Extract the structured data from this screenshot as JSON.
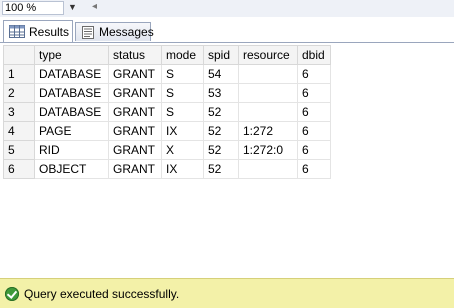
{
  "zoom": {
    "value": "100 %"
  },
  "tabs": [
    {
      "label": "Results",
      "icon": "grid-icon",
      "active": true
    },
    {
      "label": "Messages",
      "icon": "messages-icon",
      "active": false
    }
  ],
  "grid": {
    "columns": [
      "type",
      "status",
      "mode",
      "spid",
      "resource",
      "dbid"
    ],
    "rows": [
      {
        "num": "1",
        "cells": [
          "DATABASE",
          "GRANT",
          "S",
          "54",
          "",
          "6"
        ]
      },
      {
        "num": "2",
        "cells": [
          "DATABASE",
          "GRANT",
          "S",
          "53",
          "",
          "6"
        ]
      },
      {
        "num": "3",
        "cells": [
          "DATABASE",
          "GRANT",
          "S",
          "52",
          "",
          "6"
        ]
      },
      {
        "num": "4",
        "cells": [
          "PAGE",
          "GRANT",
          "IX",
          "52",
          "1:272",
          "6"
        ]
      },
      {
        "num": "5",
        "cells": [
          "RID",
          "GRANT",
          "X",
          "52",
          "1:272:0",
          "6"
        ]
      },
      {
        "num": "6",
        "cells": [
          "OBJECT",
          "GRANT",
          "IX",
          "52",
          "",
          "6"
        ]
      }
    ]
  },
  "status": {
    "text": "Query executed successfully.",
    "icon": "success-check-icon",
    "color": "#f3f1a8"
  }
}
